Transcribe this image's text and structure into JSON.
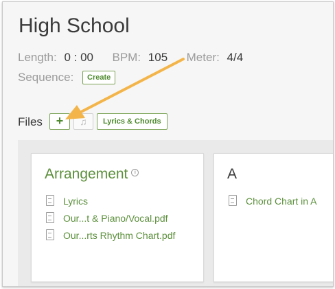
{
  "song": {
    "title": "High School",
    "length_label": "Length:",
    "length_value": "0 : 00",
    "bpm_label": "BPM:",
    "bpm_value": "105",
    "meter_label": "Meter:",
    "meter_value": "4/4",
    "sequence_label": "Sequence:",
    "sequence_button": "Create"
  },
  "files": {
    "label": "Files",
    "add_button": "+",
    "lyrics_chords_button": "Lyrics & Chords"
  },
  "arrangements": [
    {
      "title": "Arrangement",
      "files": [
        {
          "name": "Lyrics",
          "icon": "document-icon"
        },
        {
          "name": "Our...t & Piano/Vocal.pdf",
          "icon": "pdf-icon"
        },
        {
          "name": "Our...rts Rhythm Chart.pdf",
          "icon": "pdf-icon"
        }
      ]
    },
    {
      "title": "A",
      "files": [
        {
          "name": "Chord Chart in A",
          "icon": "chord-chart-icon"
        }
      ]
    }
  ],
  "colors": {
    "accent_green": "#5b8f3b",
    "annotation_arrow": "#f3b54a"
  }
}
